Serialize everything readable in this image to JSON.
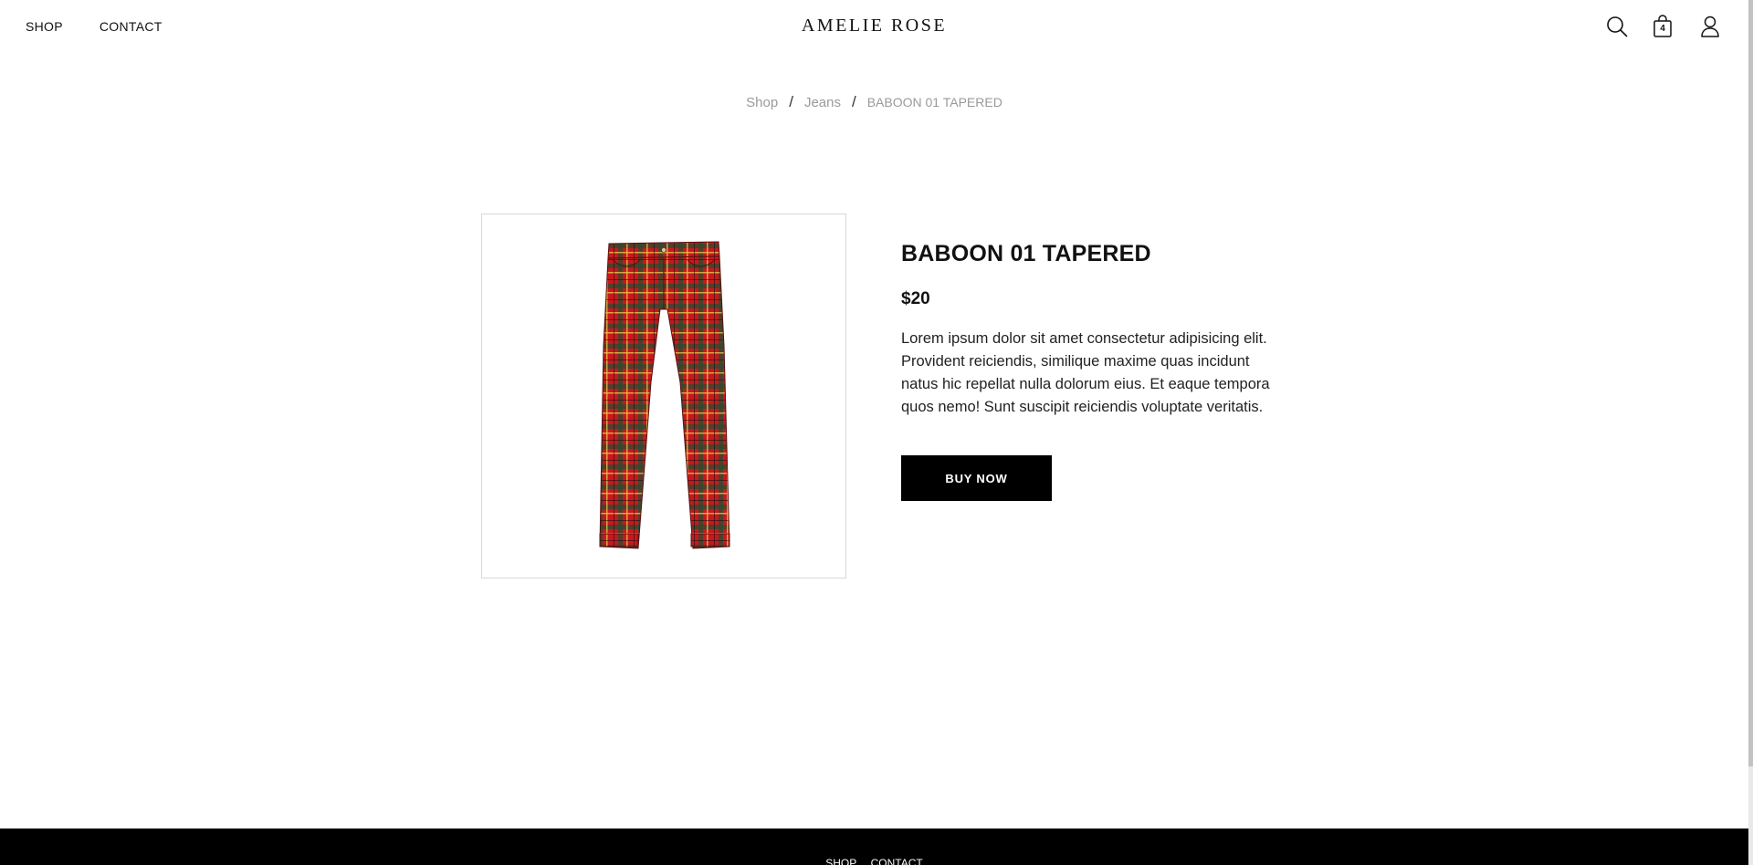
{
  "header": {
    "nav": [
      {
        "label": "SHOP"
      },
      {
        "label": "CONTACT"
      }
    ],
    "brand": "AMELIE ROSE",
    "icons": {
      "search": "search-icon",
      "cart": "shopping-bag-icon",
      "account": "user-icon"
    },
    "cart_count": "4"
  },
  "breadcrumb": {
    "items": [
      "Shop",
      "Jeans"
    ],
    "separator": "/",
    "current": "BABOON 01 TAPERED"
  },
  "product": {
    "title": "BABOON 01 TAPERED",
    "price": "$20",
    "description": "Lorem ipsum dolor sit amet consectetur adipisicing elit. Provident reiciendis, similique maxime quas incidunt natus hic repellat nulla dolorum eius. Et eaque tempora quos nemo! Sunt suscipit reiciendis voluptate veritatis.",
    "buy_label": "BUY NOW",
    "image": "red-plaid-tapered-trousers"
  },
  "footer": {
    "nav": [
      {
        "label": "SHOP"
      },
      {
        "label": "CONTACT"
      }
    ]
  },
  "colors": {
    "accent": "#000000",
    "plaid_red": "#c8181c",
    "muted_text": "#9a9a9a"
  }
}
